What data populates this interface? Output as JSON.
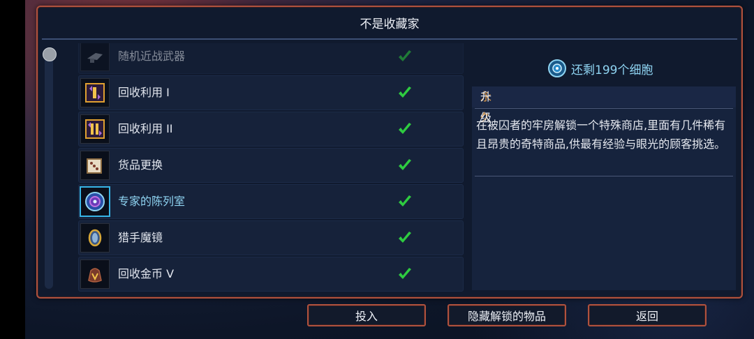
{
  "dialog": {
    "title": "不是收藏家"
  },
  "list": {
    "items": [
      {
        "label": "随机近战武器",
        "icon": "melee-weapon-icon",
        "unlocked": true,
        "faded": true
      },
      {
        "label": "回收利用 I",
        "icon": "recycle-1-icon",
        "unlocked": true
      },
      {
        "label": "回收利用 II",
        "icon": "recycle-2-icon",
        "unlocked": true
      },
      {
        "label": "货品更换",
        "icon": "dice-icon",
        "unlocked": true
      },
      {
        "label": "专家的陈列室",
        "icon": "expert-showroom-icon",
        "unlocked": true,
        "selected": true
      },
      {
        "label": "猎手魔镜",
        "icon": "hunter-mirror-icon",
        "unlocked": true
      },
      {
        "label": "回收金币 V",
        "icon": "gold-bag-icon",
        "unlocked": true
      }
    ]
  },
  "info": {
    "cells_remaining": "还剩199个细胞",
    "tag_permanent": "永久",
    "tag_upgrade": "升级",
    "description": "在被囚者的牢房解锁一个特殊商店,里面有几件稀有且昂贵的奇特商品,供最有经验与眼光的顾客挑选。"
  },
  "buttons": {
    "invest": "投入",
    "hide_unlocked": "隐藏解锁的物品",
    "back": "返回"
  },
  "colors": {
    "accent_border": "#b0523e",
    "selected": "#37b4e6",
    "check": "#2ecc40",
    "highlight_orange": "#e7a04a"
  }
}
